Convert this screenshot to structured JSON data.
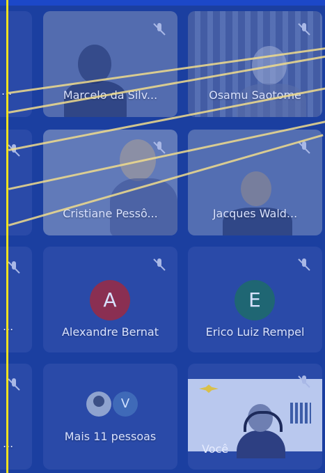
{
  "participants": [
    {
      "name": "Marcelo da Silv..."
    },
    {
      "name": "Osamu Saotome"
    },
    {
      "name": "Cristiane Pessô..."
    },
    {
      "name": "Jacques Wald..."
    },
    {
      "name": "Alexandre Bernat",
      "initial": "A"
    },
    {
      "name": "Erico Luiz Rempel",
      "initial": "E"
    }
  ],
  "more": {
    "label": "Mais 11 pessoas",
    "initial": "V"
  },
  "self": {
    "label": "Você"
  },
  "icons": {
    "mic_off": "mic-off-icon"
  },
  "colors": {
    "background": "#1b3fa0",
    "tile": "#2a4aa8",
    "accent_line": "#f3e21d"
  }
}
